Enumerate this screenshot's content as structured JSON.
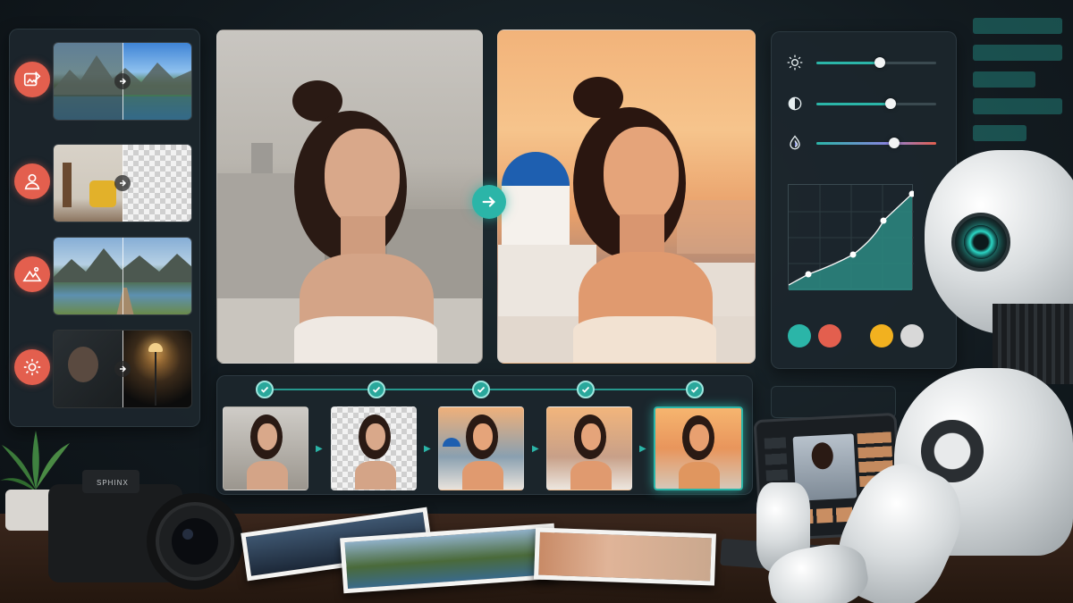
{
  "tools": [
    {
      "icon": "image-edit-icon",
      "action": "photo-enhance"
    },
    {
      "icon": "person-icon",
      "action": "background-remove"
    },
    {
      "icon": "mountain-icon",
      "action": "landscape-enhance"
    },
    {
      "icon": "sun-icon",
      "action": "relight"
    }
  ],
  "adjustments": [
    {
      "icon": "brightness-icon",
      "value": 0.53
    },
    {
      "icon": "contrast-icon",
      "value": 0.62
    },
    {
      "icon": "saturation-icon",
      "value": 0.65
    }
  ],
  "swatches": [
    "#2bb5a8",
    "#e35f4e",
    "#f2b11f",
    "#d8d8d8"
  ],
  "timeline_steps": 5,
  "camera_brand": "SPHINX",
  "colors": {
    "accent": "#2bb5a8",
    "tool_icon": "#e35f4e",
    "panel": "#1c262c"
  }
}
